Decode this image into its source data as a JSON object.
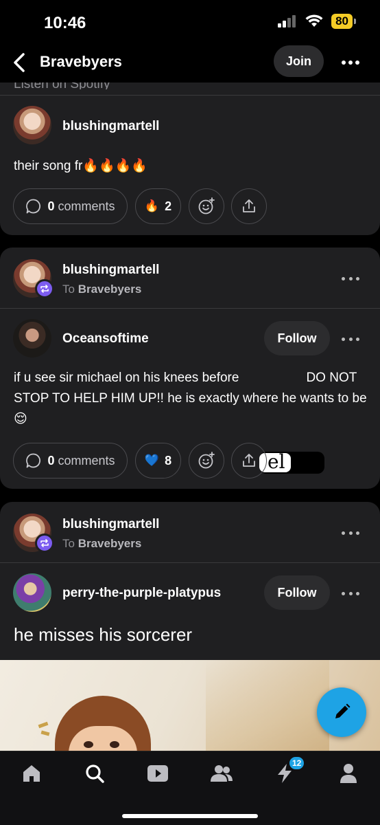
{
  "status": {
    "time": "10:46",
    "battery": "80"
  },
  "header": {
    "title": "Bravebyers",
    "join_label": "Join"
  },
  "posts": [
    {
      "peek_text": "Listen on Spotify",
      "author": "blushingmartell",
      "text": "their song fr🔥🔥🔥🔥",
      "comments_count": "0",
      "comments_label": "comments",
      "reaction_emoji": "🔥",
      "reaction_count": "2"
    },
    {
      "reblogger": "blushingmartell",
      "reblog_to_prefix": "To",
      "reblog_to": "Bravebyers",
      "author": "Oceansoftime",
      "follow_label": "Follow",
      "text_before": "if u see sir michael on his knees before",
      "redacted_visible": "el",
      "text_after": "DO NOT STOP TO HELP HIM UP!! he is exactly where he wants to be 😌",
      "comments_count": "0",
      "comments_label": "comments",
      "reaction_emoji": "💙",
      "reaction_count": "8"
    },
    {
      "reblogger": "blushingmartell",
      "reblog_to_prefix": "To",
      "reblog_to": "Bravebyers",
      "author": "perry-the-purple-platypus",
      "follow_label": "Follow",
      "text": "he misses his sorcerer"
    }
  ],
  "tabbar": {
    "activity_badge": "12"
  },
  "colors": {
    "accent": "#1ea3e5",
    "reblog_badge": "#7c5cf0",
    "battery": "#f5cc26",
    "card": "#1f1f21"
  }
}
